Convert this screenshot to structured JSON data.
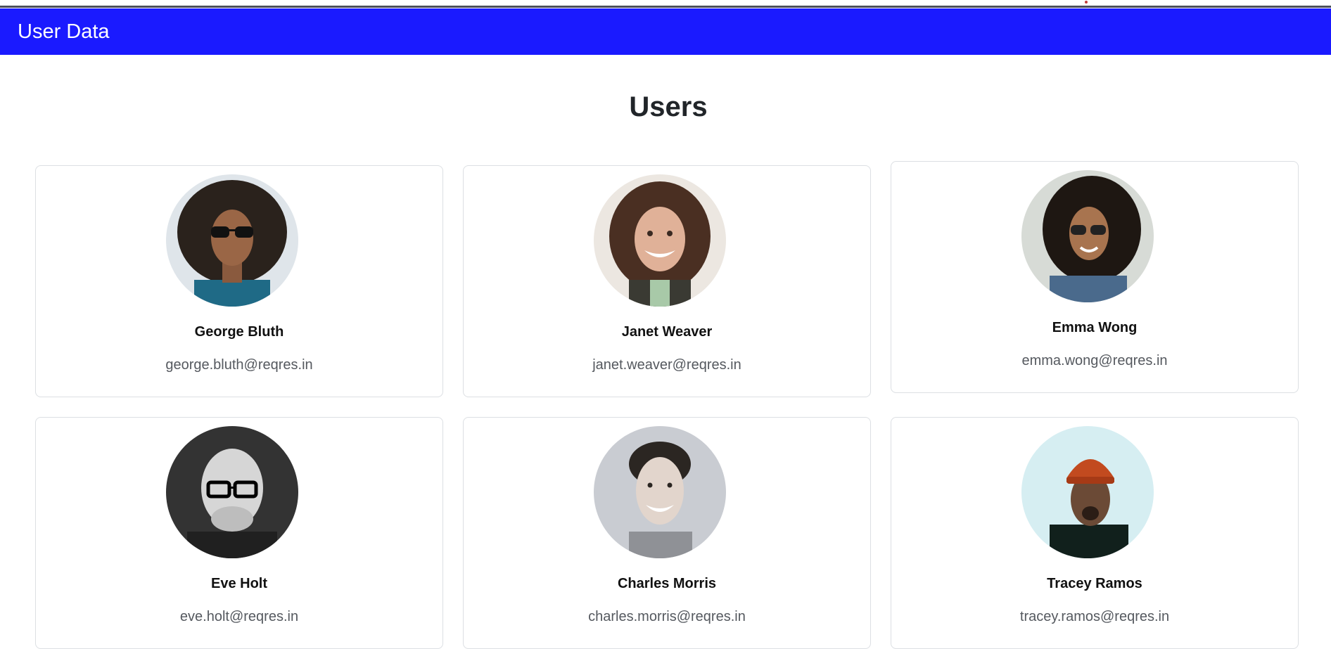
{
  "navbar": {
    "brand": "User Data"
  },
  "main": {
    "title": "Users"
  },
  "users": [
    {
      "name": "George Bluth",
      "email": "george.bluth@reqres.in"
    },
    {
      "name": "Janet Weaver",
      "email": "janet.weaver@reqres.in"
    },
    {
      "name": "Emma Wong",
      "email": "emma.wong@reqres.in"
    },
    {
      "name": "Eve Holt",
      "email": "eve.holt@reqres.in"
    },
    {
      "name": "Charles Morris",
      "email": "charles.morris@reqres.in"
    },
    {
      "name": "Tracey Ramos",
      "email": "tracey.ramos@reqres.in"
    }
  ],
  "colors": {
    "navbar": "#1a1aff",
    "card_border": "#dcdfe3",
    "email_text": "#55595f"
  }
}
